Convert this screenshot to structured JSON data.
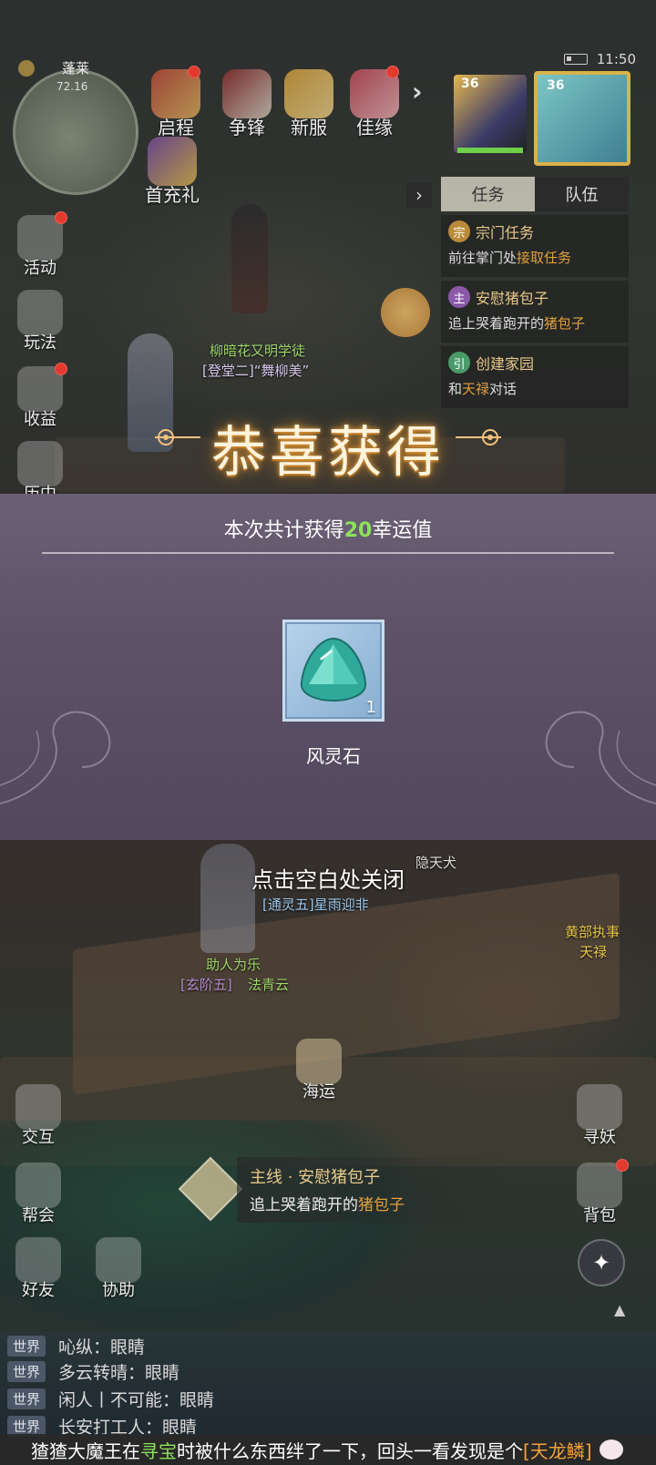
{
  "status": {
    "time": "11:50"
  },
  "map": {
    "name": "蓬莱",
    "coord": "72.16"
  },
  "top_icons": [
    {
      "label": "启程",
      "icon": "scroll-icon"
    },
    {
      "label": "争锋",
      "icon": "banner-icon"
    },
    {
      "label": "新服",
      "icon": "star-icon"
    },
    {
      "label": "佳缘",
      "icon": "flower-icon"
    }
  ],
  "recharge": {
    "label": "首充礼"
  },
  "portraits": [
    {
      "level": "36",
      "name": "companion-portrait"
    },
    {
      "level": "36",
      "name": "player-portrait"
    }
  ],
  "tasks": {
    "tab_task": "任务",
    "tab_team": "队伍",
    "items": [
      {
        "badge": "宗",
        "title": "宗门任务",
        "desc_prefix": "前往掌门处",
        "desc_hl": "接取任务",
        "desc_suffix": ""
      },
      {
        "badge": "主",
        "title": "安慰猪包子",
        "desc_prefix": "追上哭着跑开的",
        "desc_hl": "猪包子",
        "desc_suffix": ""
      },
      {
        "badge": "引",
        "title": "创建家园",
        "desc_prefix": "和",
        "desc_hl": "天禄",
        "desc_suffix": "对话"
      }
    ]
  },
  "side_left": [
    {
      "label": "活动",
      "icon": "gift-icon"
    },
    {
      "label": "玩法",
      "icon": "book-icon"
    },
    {
      "label": "收益",
      "icon": "bag-icon"
    },
    {
      "label": "历中",
      "icon": "scale-icon"
    }
  ],
  "npc": {
    "line1": "柳暗花又明学徒",
    "line2": "[登堂二]“舞柳美”"
  },
  "popup": {
    "title": "恭喜获得",
    "summary_prefix": "本次共计获得",
    "summary_value": "20",
    "summary_suffix": "幸运值",
    "item_name": "风灵石",
    "item_count": "1"
  },
  "close_hint": "点击空白处关闭",
  "scene_labels": {
    "a": "隐天犬",
    "b": "[通灵五]星雨迎非",
    "c": "助人为乐",
    "d": "[玄阶五]",
    "d2": "法青云",
    "e": "黄部执事",
    "f": "天禄"
  },
  "bottom_left": [
    {
      "label": "交互",
      "icon": "hand-icon"
    },
    {
      "label": "帮会",
      "icon": "guild-icon"
    },
    {
      "label": "好友",
      "icon": "friend-icon"
    },
    {
      "label": "协助",
      "icon": "help-icon"
    }
  ],
  "bottom_right": [
    {
      "label": "寻妖",
      "icon": "search-monster-icon"
    },
    {
      "label": "背包",
      "icon": "backpack-icon"
    }
  ],
  "ship": {
    "label": "海运"
  },
  "mainline": {
    "title": "主线 · 安慰猪包子",
    "desc_prefix": "追上哭着跑开的",
    "desc_hl": "猪包子"
  },
  "chat": [
    {
      "channel": "世界",
      "text": "吣纵：眼睛"
    },
    {
      "channel": "世界",
      "text": "多云转晴：眼睛"
    },
    {
      "channel": "世界",
      "text": "闲人丨不可能：眼睛"
    },
    {
      "channel": "世界",
      "text": "长安打工人：眼睛"
    }
  ],
  "marquee": {
    "a": "猹猹大魔王在",
    "b": "寻宝",
    "c": "时被什么东西绊了一下，回头一看发现是个",
    "d": "[天龙鳞]"
  },
  "colors": {
    "accent_green": "#8de25c",
    "accent_orange": "#e2a03d",
    "gold": "#e8c88a"
  }
}
